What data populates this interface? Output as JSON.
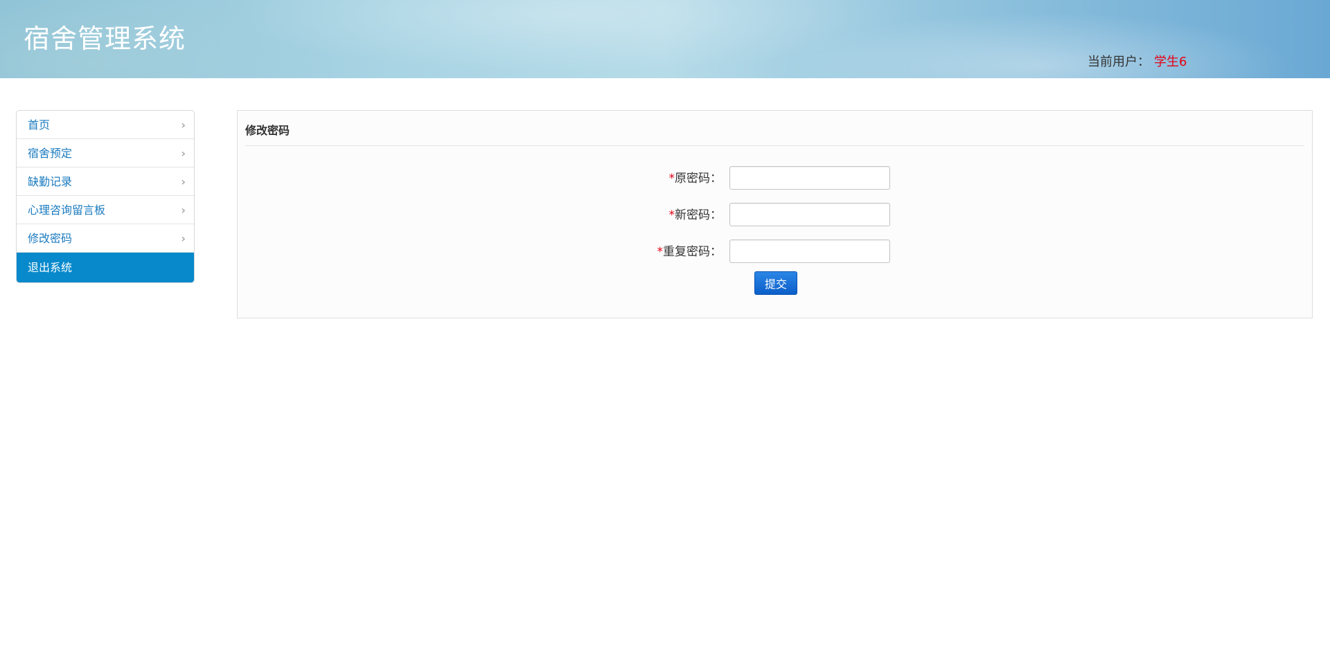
{
  "header": {
    "app_title": "宿舍管理系统",
    "user_label": "当前用户：",
    "user_name": "学生6"
  },
  "sidebar": {
    "items": [
      {
        "label": "首页"
      },
      {
        "label": "宿舍预定"
      },
      {
        "label": "缺勤记录"
      },
      {
        "label": "心理咨询留言板"
      },
      {
        "label": "修改密码"
      },
      {
        "label": "退出系统"
      }
    ],
    "chevron": "›"
  },
  "panel": {
    "title": "修改密码",
    "required_mark": "*",
    "fields": [
      {
        "label": "原密码：",
        "value": ""
      },
      {
        "label": "新密码：",
        "value": ""
      },
      {
        "label": "重复密码：",
        "value": ""
      }
    ],
    "submit_label": "提交"
  },
  "colors": {
    "accent": "#0789cc",
    "link": "#1b7bbf",
    "required": "#e60012",
    "button": "#0c5fc9"
  }
}
